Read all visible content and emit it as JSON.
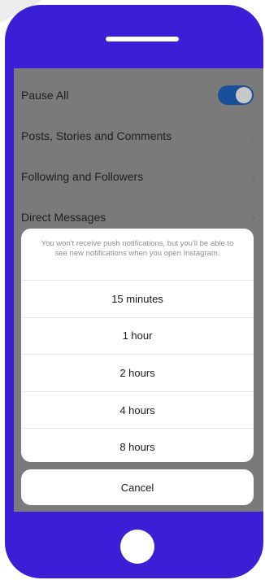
{
  "settings": {
    "pause_all": "Pause All",
    "posts": "Posts, Stories and Comments",
    "following": "Following and Followers",
    "direct": "Direct Messages"
  },
  "sheet": {
    "message": "You won't receive push notifications, but you'll be able to see new notifications when you open Instagram.",
    "options": [
      "15 minutes",
      "1 hour",
      "2 hours",
      "4 hours",
      "8 hours"
    ],
    "cancel": "Cancel"
  },
  "icons": {
    "chevron": "chevron-right-icon",
    "toggle": "toggle-switch"
  },
  "colors": {
    "phone_frame": "#3a1fd7",
    "toggle_on": "#1a4f9a"
  }
}
